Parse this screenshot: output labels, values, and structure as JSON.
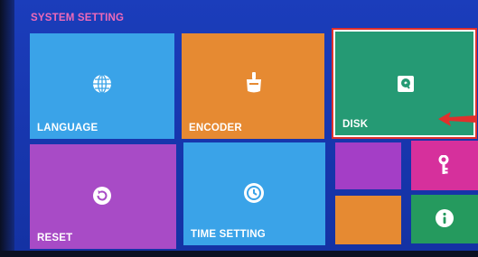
{
  "header": {
    "title": "SYSTEM SETTING"
  },
  "tiles": {
    "language": {
      "label": "LANGUAGE",
      "icon": "globe-icon",
      "color": "#3aa3e8"
    },
    "encoder": {
      "label": "ENCODER",
      "icon": "encoder-icon",
      "color": "#e68a32"
    },
    "disk": {
      "label": "DISK",
      "icon": "hard-disk-icon",
      "color": "#259a74",
      "selected": true
    },
    "reset": {
      "label": "RESET",
      "icon": "reset-icon",
      "color": "#a84bc6"
    },
    "time_setting": {
      "label": "TIME SETTING",
      "icon": "clock-icon",
      "color": "#3aa3e8"
    },
    "small_purple": {
      "color": "#a43ec6"
    },
    "key": {
      "icon": "key-icon",
      "color": "#d6309c"
    },
    "small_orange": {
      "color": "#e68a32"
    },
    "info": {
      "icon": "info-icon",
      "color": "#259a5e"
    }
  },
  "colors": {
    "title": "#f06ab8",
    "selection_outline": "#e0302c",
    "pointer_arrow": "#e0302c"
  }
}
